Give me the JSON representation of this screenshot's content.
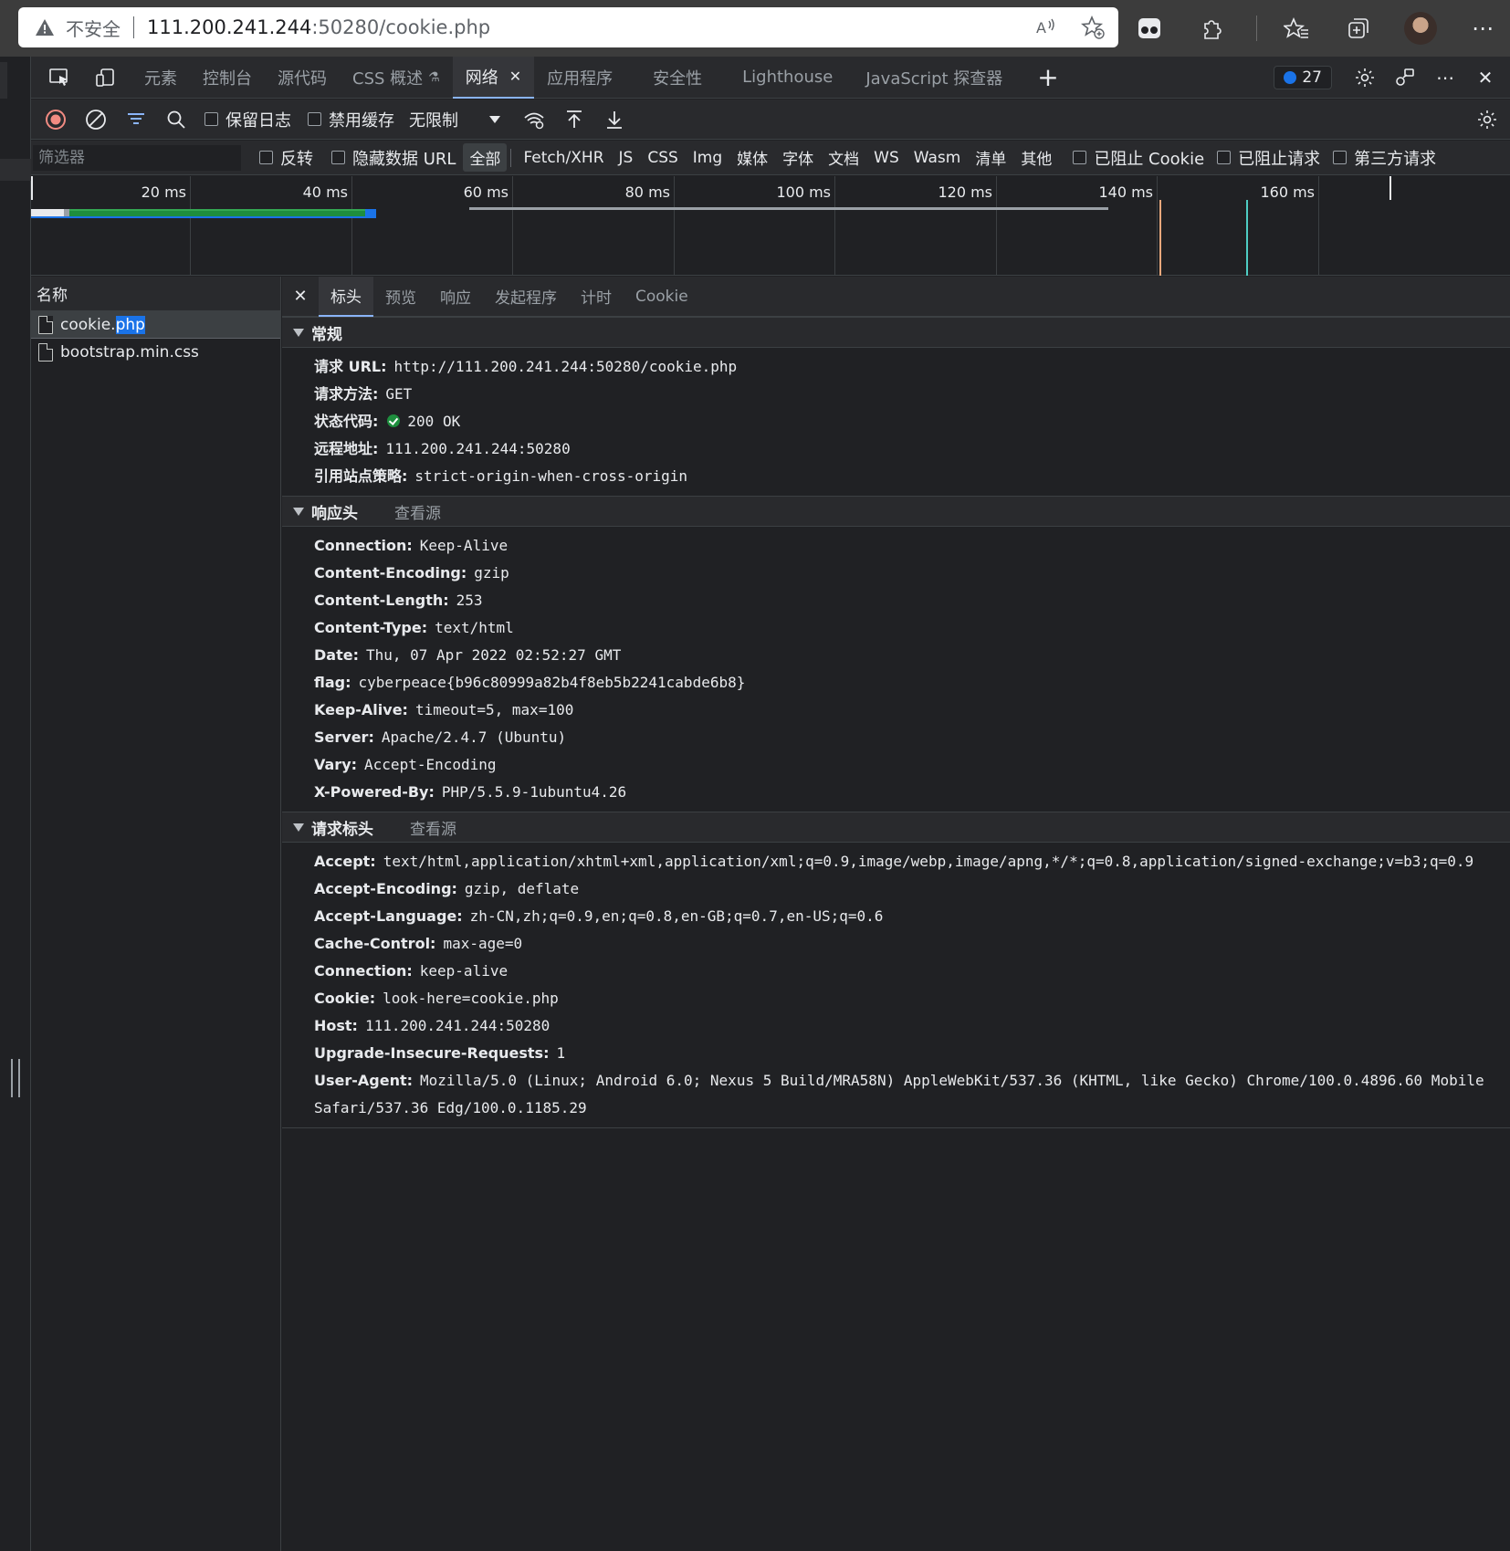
{
  "browser": {
    "insecure_label": "不安全",
    "url_host": "111.200.241.244",
    "url_rest": ":50280/cookie.php"
  },
  "devtools": {
    "tabs": [
      {
        "label": "元素"
      },
      {
        "label": "控制台"
      },
      {
        "label": "源代码"
      },
      {
        "label": "CSS 概述"
      },
      {
        "label": "网络",
        "active": true
      },
      {
        "label": "应用程序"
      },
      {
        "label": "安全性"
      },
      {
        "label": "Lighthouse"
      },
      {
        "label": "JavaScript 探查器"
      }
    ],
    "issues_count": "27",
    "toolbar": {
      "preserve_log": "保留日志",
      "disable_cache": "禁用缓存",
      "throttling": "无限制"
    },
    "filter": {
      "placeholder": "筛选器",
      "invert": "反转",
      "hide_data_url": "隐藏数据 URL",
      "types": [
        "全部",
        "Fetch/XHR",
        "JS",
        "CSS",
        "Img",
        "媒体",
        "字体",
        "文档",
        "WS",
        "Wasm",
        "清单",
        "其他"
      ],
      "blocked_cookies": "已阻止 Cookie",
      "blocked_requests": "已阻止请求",
      "third_party": "第三方请求"
    },
    "timeline": {
      "ticks": [
        "20 ms",
        "40 ms",
        "60 ms",
        "80 ms",
        "100 ms",
        "120 ms",
        "140 ms",
        "160 ms"
      ]
    },
    "requests": {
      "header": "名称",
      "items": [
        {
          "name_plain": "cookie.",
          "name_hl": "php",
          "selected": true
        },
        {
          "name_plain": "bootstrap.min.css",
          "name_hl": ""
        }
      ]
    },
    "details": {
      "tabs": [
        "标头",
        "预览",
        "响应",
        "发起程序",
        "计时",
        "Cookie"
      ],
      "general": {
        "title": "常规",
        "rows": [
          {
            "k": "请求 URL:",
            "v": "http://111.200.241.244:50280/cookie.php"
          },
          {
            "k": "请求方法:",
            "v": "GET"
          },
          {
            "k": "状态代码:",
            "v": "200 OK"
          },
          {
            "k": "远程地址:",
            "v": "111.200.241.244:50280"
          },
          {
            "k": "引用站点策略:",
            "v": "strict-origin-when-cross-origin"
          }
        ]
      },
      "response_headers": {
        "title": "响应头",
        "view_source": "查看源",
        "rows": [
          {
            "k": "Connection:",
            "v": "Keep-Alive"
          },
          {
            "k": "Content-Encoding:",
            "v": "gzip"
          },
          {
            "k": "Content-Length:",
            "v": "253"
          },
          {
            "k": "Content-Type:",
            "v": "text/html"
          },
          {
            "k": "Date:",
            "v": "Thu, 07 Apr 2022 02:52:27 GMT"
          },
          {
            "k": "flag:",
            "v": "cyberpeace{b96c80999a82b4f8eb5b2241cabde6b8}"
          },
          {
            "k": "Keep-Alive:",
            "v": "timeout=5, max=100"
          },
          {
            "k": "Server:",
            "v": "Apache/2.4.7 (Ubuntu)"
          },
          {
            "k": "Vary:",
            "v": "Accept-Encoding"
          },
          {
            "k": "X-Powered-By:",
            "v": "PHP/5.5.9-1ubuntu4.26"
          }
        ]
      },
      "request_headers": {
        "title": "请求标头",
        "view_source": "查看源",
        "rows": [
          {
            "k": "Accept:",
            "v": "text/html,application/xhtml+xml,application/xml;q=0.9,image/webp,image/apng,*/*;q=0.8,application/signed-exchange;v=b3;q=0.9"
          },
          {
            "k": "Accept-Encoding:",
            "v": "gzip, deflate"
          },
          {
            "k": "Accept-Language:",
            "v": "zh-CN,zh;q=0.9,en;q=0.8,en-GB;q=0.7,en-US;q=0.6"
          },
          {
            "k": "Cache-Control:",
            "v": "max-age=0"
          },
          {
            "k": "Connection:",
            "v": "keep-alive"
          },
          {
            "k": "Cookie:",
            "v": "look-here=cookie.php"
          },
          {
            "k": "Host:",
            "v": "111.200.241.244:50280"
          },
          {
            "k": "Upgrade-Insecure-Requests:",
            "v": "1"
          },
          {
            "k": "User-Agent:",
            "v": "Mozilla/5.0 (Linux; Android 6.0; Nexus 5 Build/MRA58N) AppleWebKit/537.36 (KHTML, like Gecko) Chrome/100.0.4896.60 Mobile Safari/537.36 Edg/100.0.1185.29"
          }
        ]
      }
    }
  }
}
